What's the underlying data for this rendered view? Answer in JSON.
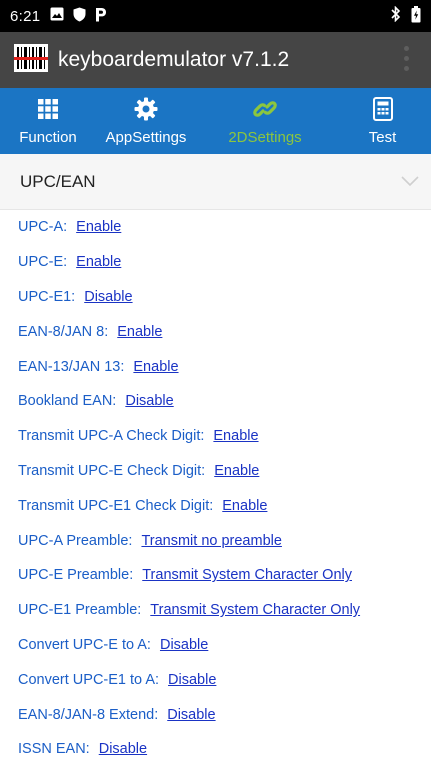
{
  "status_bar": {
    "time": "6:21",
    "icons_left": [
      "image-icon",
      "shield-icon",
      "p-icon"
    ],
    "icons_right": [
      "bluetooth-icon",
      "battery-icon"
    ]
  },
  "app_bar": {
    "title": "keyboardemulator v7.1.2",
    "logo_icon": "barcode-scanner-icon",
    "menu_icon": "overflow-menu-icon"
  },
  "tabs": [
    {
      "label": "Function",
      "icon": "grid-icon",
      "active": false
    },
    {
      "label": "AppSettings",
      "icon": "gear-icon",
      "active": false
    },
    {
      "label": "2DSettings",
      "icon": "link-icon",
      "active": true
    },
    {
      "label": "Test",
      "icon": "calculator-icon",
      "active": false
    }
  ],
  "section": {
    "title": "UPC/EAN",
    "chevron_icon": "chevron-down-icon"
  },
  "settings": [
    {
      "label": "UPC-A:",
      "value": "Enable"
    },
    {
      "label": "UPC-E:",
      "value": "Enable"
    },
    {
      "label": "UPC-E1:",
      "value": "Disable"
    },
    {
      "label": "EAN-8/JAN 8:",
      "value": "Enable"
    },
    {
      "label": "EAN-13/JAN 13:",
      "value": "Enable"
    },
    {
      "label": "Bookland EAN:",
      "value": "Disable"
    },
    {
      "label": "Transmit UPC-A Check Digit:",
      "value": "Enable"
    },
    {
      "label": "Transmit UPC-E Check Digit:",
      "value": "Enable"
    },
    {
      "label": "Transmit UPC-E1 Check Digit:",
      "value": "Enable"
    },
    {
      "label": "UPC-A Preamble:",
      "value": "Transmit no preamble"
    },
    {
      "label": "UPC-E Preamble:",
      "value": "Transmit System Character Only"
    },
    {
      "label": "UPC-E1 Preamble:",
      "value": "Transmit System Character Only"
    },
    {
      "label": "Convert UPC-E to A:",
      "value": "Disable"
    },
    {
      "label": "Convert UPC-E1 to A:",
      "value": "Disable"
    },
    {
      "label": "EAN-8/JAN-8 Extend:",
      "value": "Disable"
    },
    {
      "label": "ISSN EAN:",
      "value": "Disable"
    }
  ],
  "colors": {
    "tab_bar": "#1b75c4",
    "active_tab": "#8cc63f",
    "app_bar": "#454545",
    "link": "#1a33c4"
  }
}
